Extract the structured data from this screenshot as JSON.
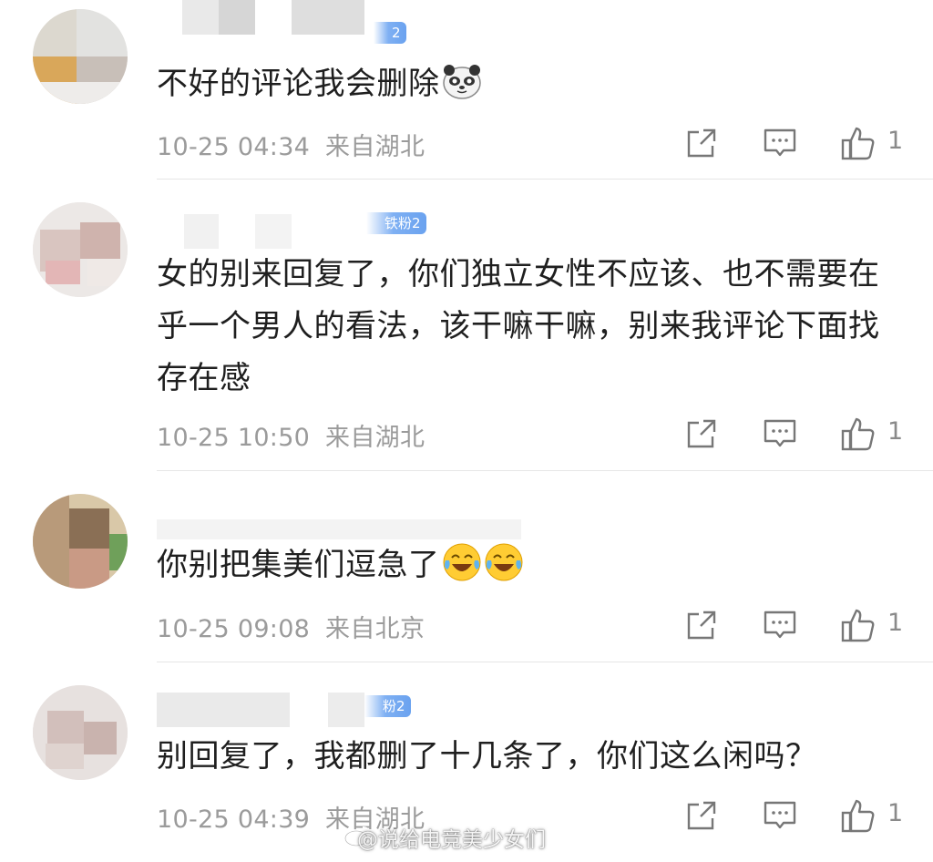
{
  "comments": [
    {
      "text": "不好的评论我会删除",
      "emoji": "panda-emoji",
      "timestamp": "10-25 04:34",
      "location": "来自湖北",
      "badge": "",
      "badge_visible": "2",
      "likes": "1"
    },
    {
      "text": "女的别来回复了，你们独立女性不应该、也不需要在乎一个男人的看法，该干嘛干嘛，别来我评论下面找存在感",
      "badge": "铁粉2",
      "timestamp": "10-25 10:50",
      "location": "来自湖北",
      "likes": "1"
    },
    {
      "text": "你别把集美们逗急了",
      "emoji": "laughing-crying-emoji",
      "timestamp": "10-25 09:08",
      "location": "来自北京",
      "likes": "1"
    },
    {
      "text": "别回复了，我都删了十几条了，你们这么闲吗？",
      "badge_visible": "粉2",
      "timestamp": "10-25 04:39",
      "location": "来自湖北",
      "likes": "1"
    }
  ],
  "icons": {
    "share": "share-icon",
    "reply": "comment-icon",
    "like": "thumbs-up-icon"
  },
  "watermark": "@说给电竞美少女们",
  "colors": {
    "meta_text": "#9b9b9b",
    "badge": "#6aa2ef",
    "divider": "#e6e6e6"
  }
}
